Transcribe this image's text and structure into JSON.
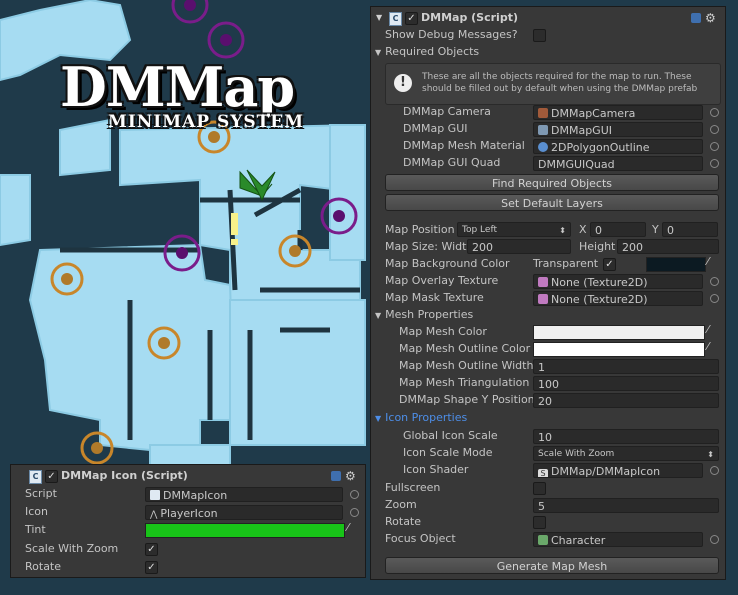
{
  "logo": {
    "title": "DMMap",
    "subtitle": "MINIMAP SYSTEM"
  },
  "script_panel": {
    "header": "DMMap (Script)",
    "show_debug_label": "Show Debug Messages?",
    "required_objects": "Required Objects",
    "info_text": "These are all the objects required for the map to run.  These should be filled out by default when using the DMMap prefab",
    "camera_label": "DMMap Camera",
    "camera_value": "DMMapCamera",
    "gui_label": "DMMap GUI",
    "gui_value": "DMMapGUI",
    "material_label": "DMMap Mesh Material",
    "material_value": "2DPolygonOutline",
    "quad_label": "DMMap GUI Quad",
    "quad_value": "DMMGUIQuad",
    "find_button": "Find Required Objects",
    "layers_button": "Set Default Layers",
    "position_label": "Map Position",
    "position_value": "Top Left",
    "x_label": "X",
    "x_value": "0",
    "y_label": "Y",
    "y_value": "0",
    "size_label": "Map Size: Width",
    "width_value": "200",
    "height_label": "Height",
    "height_value": "200",
    "bg_color_label": "Map Background Color",
    "transparent_label": "Transparent",
    "overlay_label": "Map Overlay Texture",
    "overlay_value": "None (Texture2D)",
    "mask_label": "Map Mask Texture",
    "mask_value": "None (Texture2D)",
    "mesh_props": "Mesh Properties",
    "mesh_color_label": "Map Mesh Color",
    "mesh_outline_color_label": "Map Mesh Outline Color",
    "mesh_outline_width_label": "Map Mesh Outline Width",
    "mesh_outline_width_value": "1",
    "mesh_triangulation_label": "Map Mesh Triangulation",
    "mesh_triangulation_value": "100",
    "shape_y_label": "DMMap Shape Y Position",
    "shape_y_value": "20",
    "icon_props": "Icon Properties",
    "global_scale_label": "Global Icon Scale",
    "global_scale_value": "10",
    "scale_mode_label": "Icon Scale Mode",
    "scale_mode_value": "Scale With Zoom",
    "shader_label": "Icon Shader",
    "shader_value": "DMMap/DMMapIcon",
    "fullscreen_label": "Fullscreen",
    "zoom_label": "Zoom",
    "zoom_value": "5",
    "rotate_label": "Rotate",
    "focus_label": "Focus Object",
    "focus_value": "Character",
    "generate_button": "Generate Map Mesh"
  },
  "icon_panel": {
    "header": "DMMap Icon (Script)",
    "script_label": "Script",
    "script_value": "DMMapIcon",
    "icon_label": "Icon",
    "icon_value": "PlayerIcon",
    "tint_label": "Tint",
    "scale_zoom_label": "Scale With Zoom",
    "rotate_label": "Rotate"
  },
  "colors": {
    "map_bg": "#1f3a4a",
    "floor": "#a6dcf2",
    "tint": "#18c418",
    "icon_props": "#4d8ee8",
    "bg_swatch": "#0c1a22"
  }
}
